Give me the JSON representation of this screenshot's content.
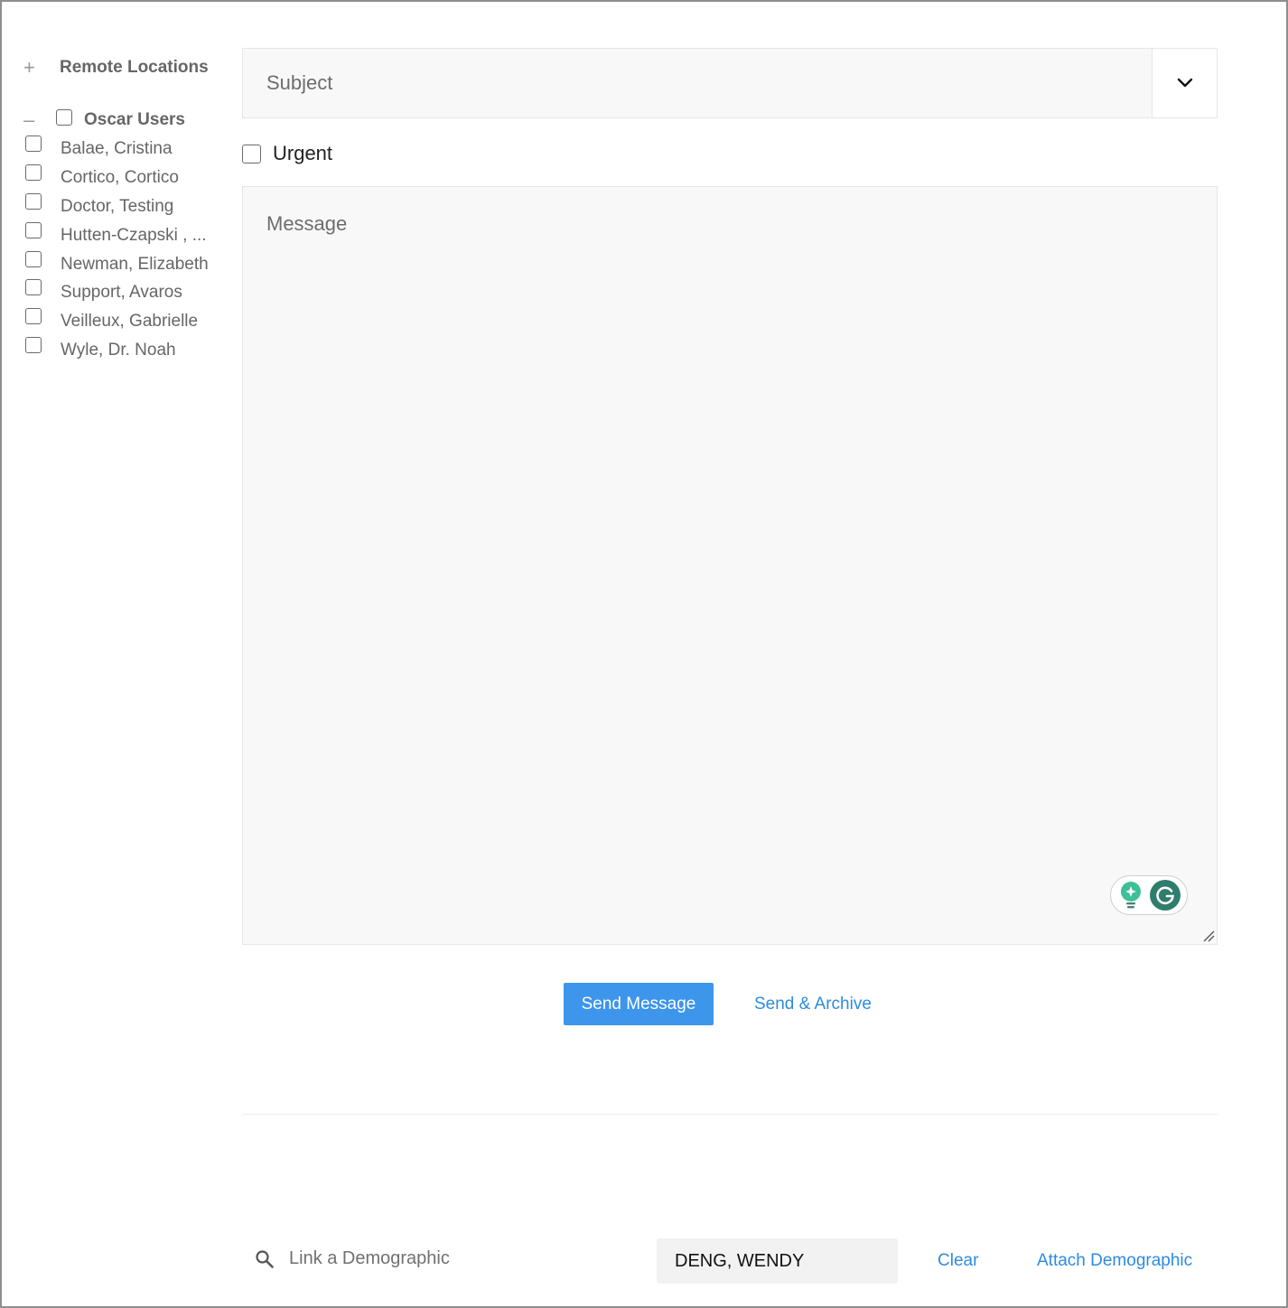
{
  "sidebar": {
    "remote_locations": {
      "expander": "+",
      "label": "Remote Locations"
    },
    "oscar_users": {
      "expander": "–",
      "label": "Oscar Users",
      "checked": false
    },
    "users": [
      {
        "label": "Balae, Cristina",
        "checked": false
      },
      {
        "label": "Cortico, Cortico",
        "checked": false
      },
      {
        "label": "Doctor, Testing",
        "checked": false
      },
      {
        "label": "Hutten-Czapski , ...",
        "checked": false
      },
      {
        "label": "Newman, Elizabeth",
        "checked": false
      },
      {
        "label": "Support, Avaros",
        "checked": false
      },
      {
        "label": "Veilleux, Gabrielle",
        "checked": false
      },
      {
        "label": "Wyle, Dr. Noah",
        "checked": false
      }
    ]
  },
  "compose": {
    "subject_placeholder": "Subject",
    "urgent_label": "Urgent",
    "urgent_checked": false,
    "message_placeholder": "Message"
  },
  "actions": {
    "send_label": "Send Message",
    "send_archive_label": "Send & Archive"
  },
  "demographic": {
    "search_placeholder": "Link a Demographic",
    "selected_name": "DENG, WENDY",
    "clear_label": "Clear",
    "attach_label": "Attach Demographic"
  },
  "colors": {
    "primary": "#3d95ec",
    "link": "#2d8be0",
    "grammarly": "#2f7d6c"
  },
  "icons": [
    "plus-icon",
    "minus-icon",
    "chevron-down-icon",
    "search-icon",
    "grammarly-bulb-icon",
    "grammarly-logo-icon",
    "resize-handle-icon"
  ]
}
